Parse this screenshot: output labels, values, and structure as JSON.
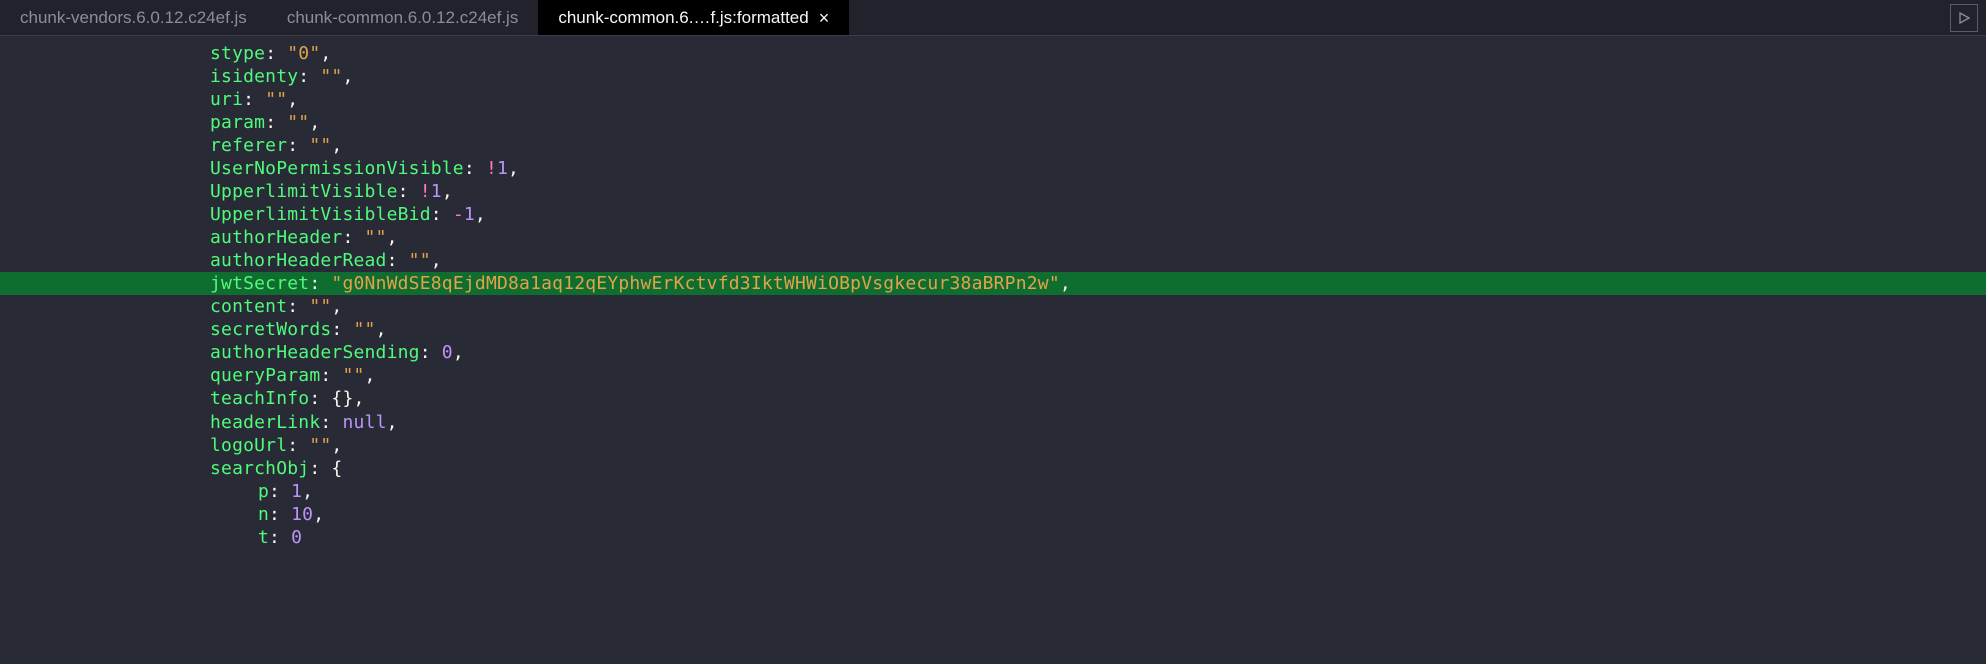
{
  "tabs": {
    "t0": "chunk-vendors.6.0.12.c24ef.js",
    "t1": "chunk-common.6.0.12.c24ef.js",
    "t2": "chunk-common.6.…f.js:formatted",
    "close": "×"
  },
  "code": {
    "stype_key": "stype",
    "stype_val": "\"0\"",
    "isidenty_key": "isidenty",
    "isidenty_val": "\"\"",
    "uri_key": "uri",
    "uri_val": "\"\"",
    "param_key": "param",
    "param_val": "\"\"",
    "referer_key": "referer",
    "referer_val": "\"\"",
    "userNoPerm_key": "UserNoPermissionVisible",
    "userNoPerm_val": "1",
    "upperlimit_key": "UpperlimitVisible",
    "upperlimit_val": "1",
    "upperlimitBid_key": "UpperlimitVisibleBid",
    "upperlimitBid_val": "1",
    "authorHeader_key": "authorHeader",
    "authorHeader_val": "\"\"",
    "authorHeaderRead_key": "authorHeaderRead",
    "authorHeaderRead_val": "\"\"",
    "jwtSecret_key": "jwtSecret",
    "jwtSecret_val": "\"g0NnWdSE8qEjdMD8a1aq12qEYphwErKctvfd3IktWHWiOBpVsgkecur38aBRPn2w\"",
    "content_key": "content",
    "content_val": "\"\"",
    "secretWords_key": "secretWords",
    "secretWords_val": "\"\"",
    "authorHeaderSending_key": "authorHeaderSending",
    "authorHeaderSending_val": "0",
    "queryParam_key": "queryParam",
    "queryParam_val": "\"\"",
    "teachInfo_key": "teachInfo",
    "headerLink_key": "headerLink",
    "headerLink_val": "null",
    "logoUrl_key": "logoUrl",
    "logoUrl_val": "\"\"",
    "searchObj_key": "searchObj",
    "p_key": "p",
    "p_val": "1",
    "n_key": "n",
    "n_val": "10",
    "t_key": "t",
    "t_val": "0"
  }
}
